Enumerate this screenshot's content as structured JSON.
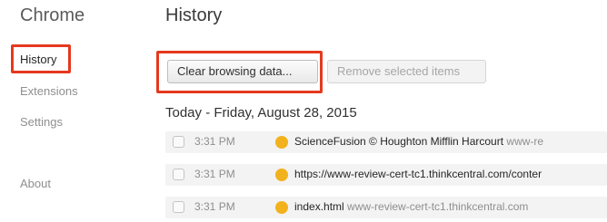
{
  "app_title": "Chrome",
  "page_title": "History",
  "sidebar": {
    "items": [
      {
        "label": "History",
        "active": true
      },
      {
        "label": "Extensions"
      },
      {
        "label": "Settings"
      },
      {
        "label": "About"
      }
    ]
  },
  "toolbar": {
    "clear_label": "Clear browsing data...",
    "remove_label": "Remove selected items"
  },
  "history": {
    "date_heading": "Today - Friday, August 28, 2015",
    "entries": [
      {
        "time": "3:31 PM",
        "title": "ScienceFusion © Houghton Mifflin Harcourt",
        "domain": "www-re",
        "favicon": "orange-circle-icon"
      },
      {
        "time": "3:31 PM",
        "title": "https://www-review-cert-tc1.thinkcentral.com/conter",
        "domain": "",
        "favicon": "orange-circle-icon"
      },
      {
        "time": "3:31 PM",
        "title": "index.html",
        "domain": "www-review-cert-tc1.thinkcentral.com",
        "favicon": "orange-circle-icon"
      }
    ]
  },
  "colors": {
    "highlight": "#e5391e",
    "favicon": "#f2b21d"
  }
}
